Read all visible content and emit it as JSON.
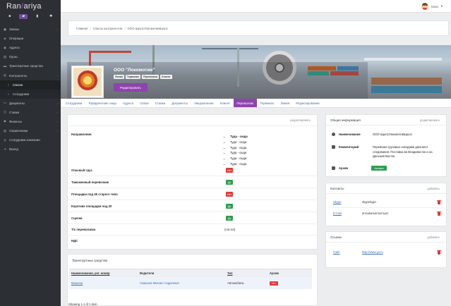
{
  "app": {
    "logo_left": "Ran",
    "logo_mid": "/",
    "logo_right": "ariya"
  },
  "sidebar": {
    "tools": [
      {
        "icon": "monitor-icon",
        "glyph": "■"
      },
      {
        "icon": "folder-icon",
        "glyph": "▰"
      },
      {
        "icon": "chart-icon",
        "glyph": "▮"
      },
      {
        "icon": "gear-icon",
        "glyph": "✱"
      }
    ],
    "items": [
      {
        "label": "Заказы",
        "icon": "box-icon",
        "glyph": "▣",
        "arrow": "‹"
      },
      {
        "label": "Операции",
        "icon": "operations-icon",
        "glyph": "◈",
        "arrow": ""
      },
      {
        "label": "Адреса",
        "icon": "map-pin-icon",
        "glyph": "◉",
        "arrow": ""
      },
      {
        "label": "Грузы",
        "icon": "cargo-icon",
        "glyph": "▤",
        "arrow": ""
      },
      {
        "label": "Транспортные средства",
        "icon": "truck-icon",
        "glyph": "▬",
        "arrow": ""
      },
      {
        "label": "Контрагенты",
        "icon": "users-icon",
        "glyph": "◍",
        "arrow": "‹"
      },
      {
        "label": "Список",
        "icon": "circle-icon",
        "glyph": "○",
        "arrow": "",
        "sub": true,
        "active": true
      },
      {
        "label": "Сотрудники",
        "icon": "circle-icon",
        "glyph": "○",
        "arrow": "",
        "sub": true
      },
      {
        "label": "Документы",
        "icon": "document-icon",
        "glyph": "▭",
        "arrow": "‹"
      },
      {
        "label": "Ставки",
        "icon": "rates-icon",
        "glyph": "◫",
        "arrow": "‹"
      },
      {
        "label": "Финансы",
        "icon": "finance-icon",
        "glyph": "◆",
        "arrow": "‹"
      },
      {
        "label": "Справочники",
        "icon": "book-icon",
        "glyph": "▥",
        "arrow": "‹"
      },
      {
        "label": "Сотрудники компании",
        "icon": "staff-icon",
        "glyph": "◎",
        "arrow": ""
      },
      {
        "label": "Выход",
        "icon": "logout-icon",
        "glyph": "➜",
        "arrow": ""
      }
    ]
  },
  "topbar": {
    "username": "boss",
    "caret": "▾"
  },
  "breadcrumb": {
    "items": [
      "Главная",
      "Список контрагентов",
      "ООО &quot;Локомотив&quot;"
    ],
    "sep": "/"
  },
  "profile": {
    "name": "ООО \"Локомотив\"",
    "badges": [
      "Линия",
      "Терминал",
      "Перевозчик",
      "Клиент"
    ],
    "edit_label": "Редактировать"
  },
  "tabs": [
    "Сотрудники",
    "Юридические лица",
    "Адреса",
    "Связи",
    "Ставки",
    "Документы",
    "Уведомления",
    "Клиент",
    "Перевозчик",
    "Терминал",
    "Линия",
    "Редактирование"
  ],
  "active_tab": "Перевозчик",
  "carrier": {
    "edit_label": "редактировать",
    "directions_label": "Направления",
    "directions": [
      "Туда - сюда",
      "Туда - сюда",
      "Туда - сюда",
      "Туда - сюда",
      "Туда - сюда",
      "Туда - сюда"
    ],
    "flags": [
      {
        "label": "Опасный груз",
        "value": "Нет",
        "ok": false
      },
      {
        "label": "Таможенный перевозчик",
        "value": "Да",
        "ok": true
      },
      {
        "label": "Площадки под 45 старого типа",
        "value": "Нет",
        "ok": false
      },
      {
        "label": "Короткие площадки под 20",
        "value": "Да",
        "ok": true
      },
      {
        "label": "Сцепки",
        "value": "Да",
        "ok": true
      }
    ],
    "ts_label": "Т/с перевозчика",
    "ts_value": "(not set)",
    "nds_label": "НДС"
  },
  "vehicles": {
    "title": "Транспортные средства",
    "headers": [
      "Наименование, рег. номер",
      "Водители",
      "Тип",
      "Архив"
    ],
    "rows": [
      {
        "name": "Машина",
        "driver": "Смирнов Михаил Андреевич",
        "type": "Автомобиль",
        "archive": "Нет"
      }
    ],
    "showing": "Showing 1-1 of 1 item."
  },
  "general": {
    "title": "Общая информация",
    "edit_label": "редактировать",
    "name_label": "Наименование",
    "name_value": "ООО &quot;Локомотив&quot;",
    "comment_label": "Комментарий",
    "comment_value": "Перевозка грузовых поездами дальнего следования. Поставка во Владивосток и на Дальний Восток.",
    "archive_label": "Архив",
    "archive_value": "Активен"
  },
  "contacts": {
    "title": "Контакты",
    "add_label": "добавить",
    "items": [
      {
        "type": "Skype",
        "value": "skypelogin"
      },
      {
        "type": "E-mail",
        "value": "аптыватыптыптыат"
      }
    ]
  },
  "links": {
    "title": "Ссылки",
    "add_label": "добавить",
    "items": [
      {
        "type": "Сайт",
        "value": "http://www.ya.ru"
      }
    ]
  },
  "colors": {
    "accent": "#8e44ad",
    "sidebar": "#2c2f33",
    "yes": "#2e9e4f",
    "no": "#e53935",
    "link": "#3c6fb0"
  }
}
